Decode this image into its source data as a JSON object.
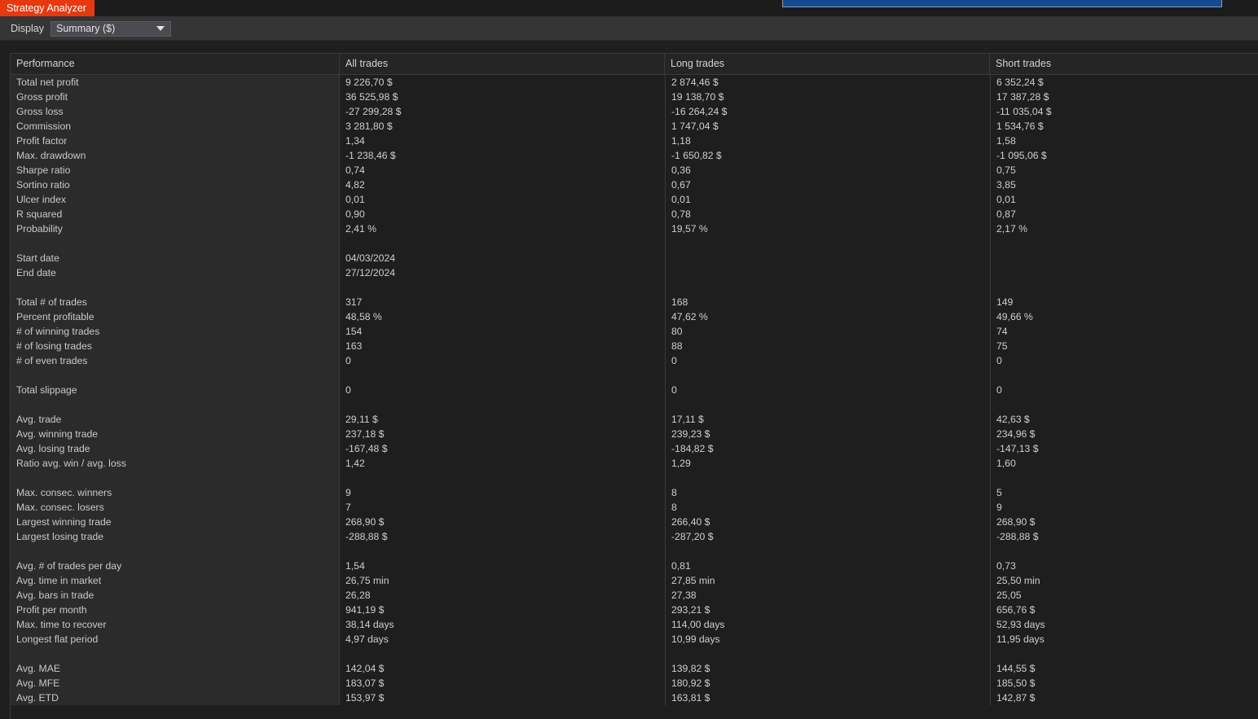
{
  "window": {
    "tab_title": "Strategy Analyzer",
    "accent_color": "#e8380d",
    "highlight_color": "#164b93",
    "negative_color": "#f01414"
  },
  "toolbar": {
    "display_label": "Display",
    "display_value": "Summary ($)",
    "display_options": [
      "Summary ($)"
    ],
    "caret_icon": "chevron-down-icon"
  },
  "table": {
    "columns": [
      "Performance",
      "All trades",
      "Long trades",
      "Short trades"
    ],
    "rows": [
      {
        "label": "Total net profit",
        "all": "9 226,70 $",
        "long": "2 874,46 $",
        "short": "6 352,24 $"
      },
      {
        "label": "Gross profit",
        "all": "36 525,98 $",
        "long": "19 138,70 $",
        "short": "17 387,28 $"
      },
      {
        "label": "Gross loss",
        "all": "-27 299,28 $",
        "long": "-16 264,24 $",
        "short": "-11 035,04 $",
        "negative": true
      },
      {
        "label": "Commission",
        "all": "3 281,80 $",
        "long": "1 747,04 $",
        "short": "1 534,76 $"
      },
      {
        "label": "Profit factor",
        "all": "1,34",
        "long": "1,18",
        "short": "1,58"
      },
      {
        "label": "Max. drawdown",
        "all": "-1 238,46 $",
        "long": "-1 650,82 $",
        "short": "-1 095,06 $",
        "negative": true
      },
      {
        "label": "Sharpe ratio",
        "all": "0,74",
        "long": "0,36",
        "short": "0,75"
      },
      {
        "label": "Sortino ratio",
        "all": "4,82",
        "long": "0,67",
        "short": "3,85"
      },
      {
        "label": "Ulcer index",
        "all": "0,01",
        "long": "0,01",
        "short": "0,01"
      },
      {
        "label": "R squared",
        "all": "0,90",
        "long": "0,78",
        "short": "0,87"
      },
      {
        "label": "Probability",
        "all": "2,41 %",
        "long": "19,57 %",
        "short": "2,17 %"
      },
      {
        "label": "",
        "all": "",
        "long": "",
        "short": "",
        "spacer": true
      },
      {
        "label": "Start date",
        "all": "04/03/2024",
        "long": "",
        "short": ""
      },
      {
        "label": "End date",
        "all": "27/12/2024",
        "long": "",
        "short": ""
      },
      {
        "label": "",
        "all": "",
        "long": "",
        "short": "",
        "spacer": true
      },
      {
        "label": "Total # of trades",
        "all": "317",
        "long": "168",
        "short": "149"
      },
      {
        "label": "Percent profitable",
        "all": "48,58 %",
        "long": "47,62 %",
        "short": "49,66 %"
      },
      {
        "label": "# of winning trades",
        "all": "154",
        "long": "80",
        "short": "74"
      },
      {
        "label": "# of losing trades",
        "all": "163",
        "long": "88",
        "short": "75"
      },
      {
        "label": "# of even trades",
        "all": "0",
        "long": "0",
        "short": "0"
      },
      {
        "label": "",
        "all": "",
        "long": "",
        "short": "",
        "spacer": true
      },
      {
        "label": "Total slippage",
        "all": "0",
        "long": "0",
        "short": "0"
      },
      {
        "label": "",
        "all": "",
        "long": "",
        "short": "",
        "spacer": true
      },
      {
        "label": "Avg. trade",
        "all": "29,11 $",
        "long": "17,11 $",
        "short": "42,63 $"
      },
      {
        "label": "Avg. winning trade",
        "all": "237,18 $",
        "long": "239,23 $",
        "short": "234,96 $"
      },
      {
        "label": "Avg. losing trade",
        "all": "-167,48 $",
        "long": "-184,82 $",
        "short": "-147,13 $",
        "negative": true
      },
      {
        "label": "Ratio avg. win / avg. loss",
        "all": "1,42",
        "long": "1,29",
        "short": "1,60"
      },
      {
        "label": "",
        "all": "",
        "long": "",
        "short": "",
        "spacer": true
      },
      {
        "label": "Max. consec. winners",
        "all": "9",
        "long": "8",
        "short": "5"
      },
      {
        "label": "Max. consec. losers",
        "all": "7",
        "long": "8",
        "short": "9"
      },
      {
        "label": "Largest winning trade",
        "all": "268,90 $",
        "long": "266,40 $",
        "short": "268,90 $"
      },
      {
        "label": "Largest losing trade",
        "all": "-288,88 $",
        "long": "-287,20 $",
        "short": "-288,88 $",
        "negative": true
      },
      {
        "label": "",
        "all": "",
        "long": "",
        "short": "",
        "spacer": true
      },
      {
        "label": "Avg. # of trades per day",
        "all": "1,54",
        "long": "0,81",
        "short": "0,73"
      },
      {
        "label": "Avg. time in market",
        "all": "26,75 min",
        "long": "27,85 min",
        "short": "25,50 min"
      },
      {
        "label": "Avg. bars in trade",
        "all": "26,28",
        "long": "27,38",
        "short": "25,05"
      },
      {
        "label": "Profit per month",
        "all": "941,19 $",
        "long": "293,21 $",
        "short": "656,76 $"
      },
      {
        "label": "Max. time to recover",
        "all": "38,14 days",
        "long": "114,00 days",
        "short": "52,93 days"
      },
      {
        "label": "Longest flat period",
        "all": "4,97 days",
        "long": "10,99 days",
        "short": "11,95 days"
      },
      {
        "label": "",
        "all": "",
        "long": "",
        "short": "",
        "spacer": true
      },
      {
        "label": "Avg. MAE",
        "all": "142,04 $",
        "long": "139,82 $",
        "short": "144,55 $"
      },
      {
        "label": "Avg. MFE",
        "all": "183,07 $",
        "long": "180,92 $",
        "short": "185,50 $"
      },
      {
        "label": "Avg. ETD",
        "all": "153,97 $",
        "long": "163,81 $",
        "short": "142,87 $"
      }
    ]
  }
}
